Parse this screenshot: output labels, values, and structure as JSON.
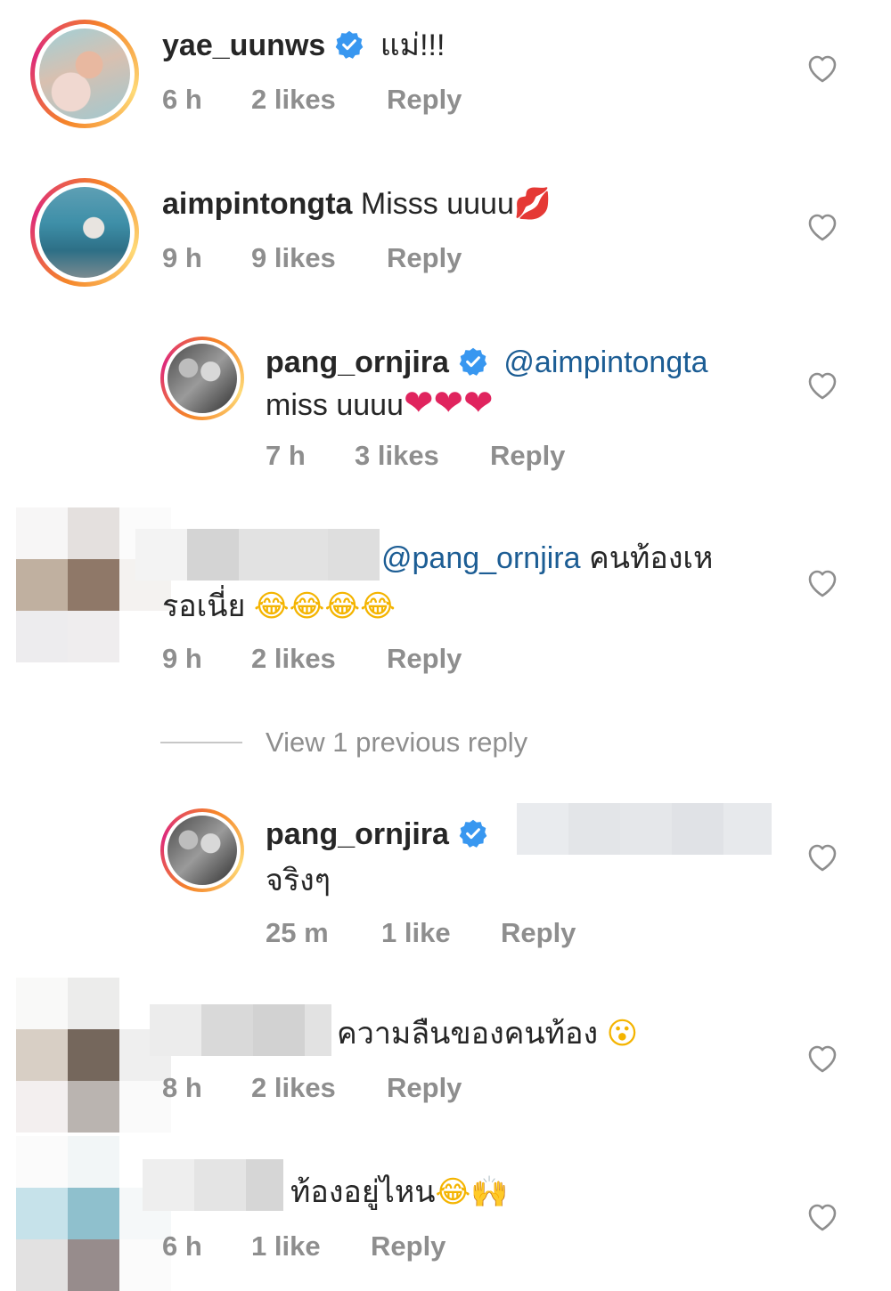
{
  "comments": [
    {
      "username": "yae_uunws",
      "text": "แม่!!!",
      "time": "6 h",
      "likes": "2 likes",
      "reply": "Reply"
    },
    {
      "username": "aimpintongta",
      "text": "Misss uuuu",
      "emoji": "💋",
      "time": "9 h",
      "likes": "9 likes",
      "reply": "Reply"
    },
    {
      "username": "pang_ornjira",
      "mention": "@aimpintongta",
      "text": "miss uuuu",
      "emoji": "❤❤❤",
      "time": "7 h",
      "likes": "3 likes",
      "reply": "Reply"
    },
    {
      "mention": "@pang_ornjira",
      "text_line1": "คนท้องเห",
      "text_line2": "รอเนี่ย",
      "emoji": "😂😂😂😂",
      "time": "9 h",
      "likes": "2 likes",
      "reply": "Reply"
    },
    {
      "username": "pang_ornjira",
      "text": "จริงๆ",
      "time": "25 m",
      "likes": "1 like",
      "reply": "Reply"
    },
    {
      "text": "ความลืนของคนท้อง",
      "emoji": "😮",
      "time": "8 h",
      "likes": "2 likes",
      "reply": "Reply"
    },
    {
      "text": "ท้องอยู่ไหน",
      "emoji": "😂🙌",
      "time": "6 h",
      "likes": "1 like",
      "reply": "Reply"
    }
  ],
  "view_previous": "View 1 previous reply",
  "colors": {
    "verified": "#3897f0",
    "mention": "#1c5d94",
    "meta": "#8e8e8e",
    "heart_stroke": "#8e8e8e"
  }
}
